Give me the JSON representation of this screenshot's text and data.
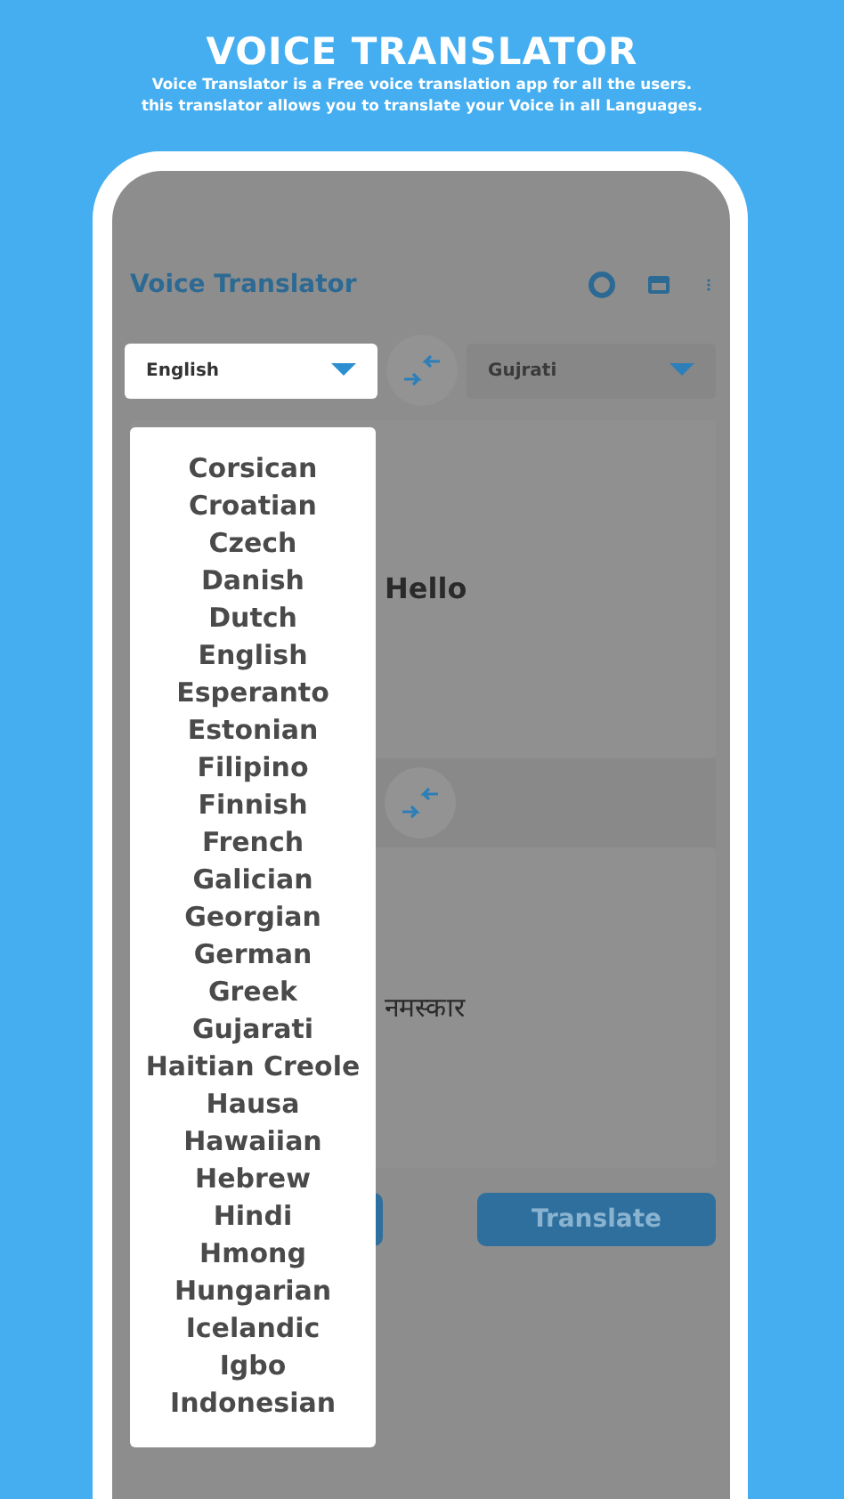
{
  "header": {
    "title": "VOICE TRANSLATOR",
    "description_lines": [
      "Voice Translator is a Free voice translation app for all the users.",
      "this translator allows you to translate your Voice in all Languages."
    ]
  },
  "app": {
    "title": "Voice Translator"
  },
  "source_language": {
    "value": "English"
  },
  "target_language": {
    "value": "Gujrati"
  },
  "input_text": "Hello",
  "output_text": "नमस्कार",
  "translate_button": "Translate",
  "language_list": [
    "Corsican",
    "Croatian",
    "Czech",
    "Danish",
    "Dutch",
    "English",
    "Esperanto",
    "Estonian",
    "Filipino",
    "Finnish",
    "French",
    "Galician",
    "Georgian",
    "German",
    "Greek",
    "Gujarati",
    "Haitian Creole",
    "Hausa",
    "Hawaiian",
    "Hebrew",
    "Hindi",
    "Hmong",
    "Hungarian",
    "Icelandic",
    "Igbo",
    "Indonesian"
  ]
}
